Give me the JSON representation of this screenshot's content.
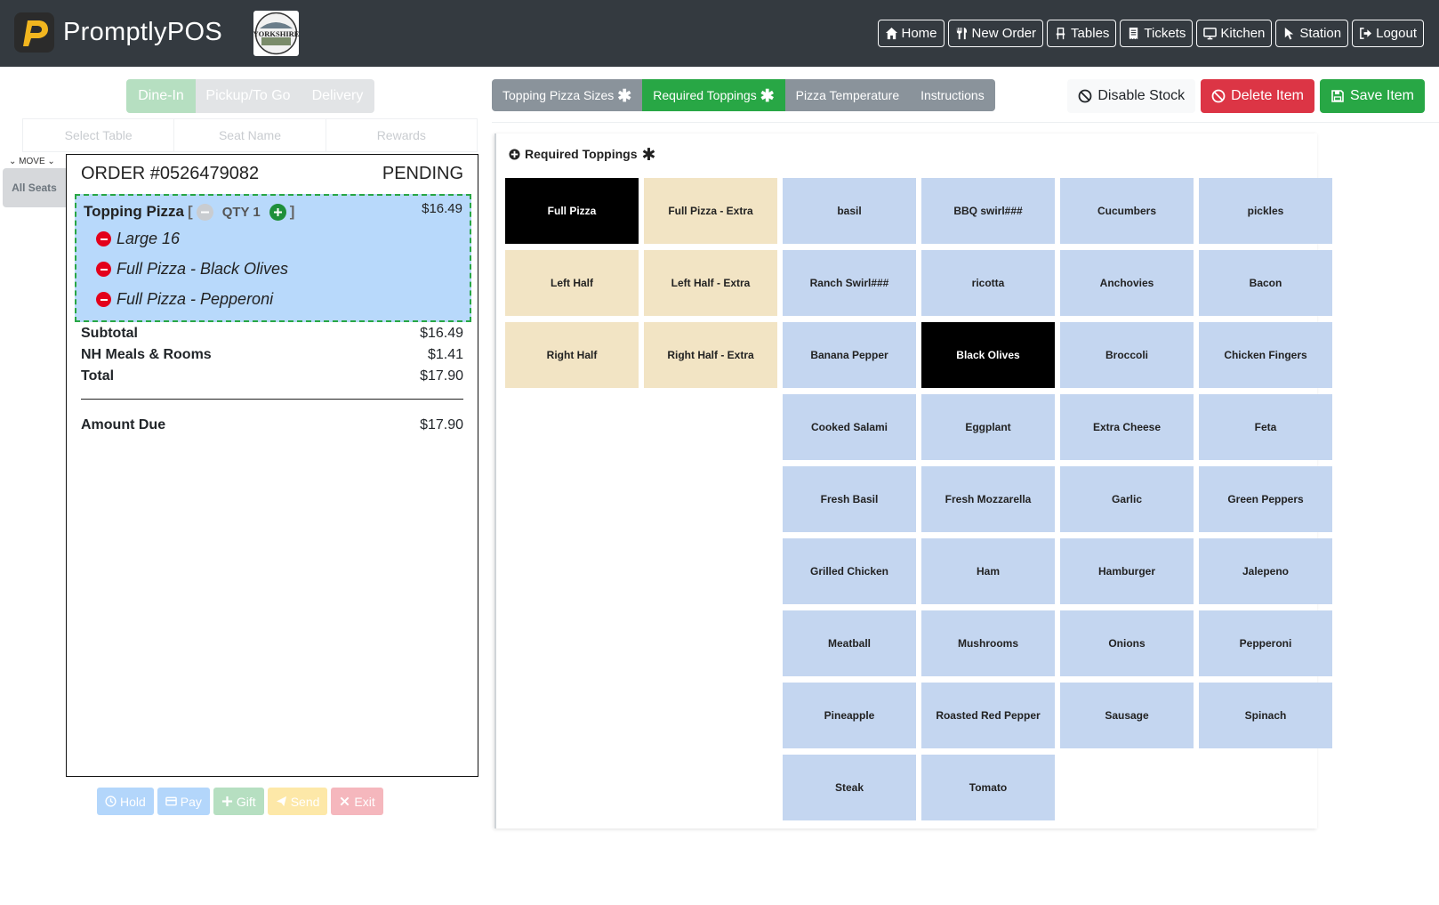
{
  "brand": {
    "name": "PromptlyPOS",
    "logo_letter": "P",
    "partner_text": "YORKSHIRE"
  },
  "nav": [
    {
      "label": "Home",
      "icon": "home-icon"
    },
    {
      "label": "New Order",
      "icon": "utensils-icon"
    },
    {
      "label": "Tables",
      "icon": "chair-icon"
    },
    {
      "label": "Tickets",
      "icon": "receipt-icon"
    },
    {
      "label": "Kitchen",
      "icon": "monitor-icon"
    },
    {
      "label": "Station",
      "icon": "pointer-icon"
    },
    {
      "label": "Logout",
      "icon": "logout-icon"
    }
  ],
  "order_types": [
    "Dine-In",
    "Pickup/To Go",
    "Delivery"
  ],
  "subbar": [
    "Select Table",
    "Seat Name",
    "Rewards"
  ],
  "seats": {
    "move_label": "MOVE",
    "all_seats": "All Seats"
  },
  "order": {
    "number": "ORDER #0526479082",
    "status": "PENDING",
    "item": {
      "name": "Topping Pizza",
      "qty": "QTY 1",
      "price": "$16.49",
      "open_bracket": "[",
      "close_bracket": "]",
      "modifiers": [
        "Large 16",
        "Full Pizza - Black Olives",
        "Full Pizza - Pepperoni"
      ]
    },
    "subtotal_label": "Subtotal",
    "subtotal": "$16.49",
    "tax_label": "NH Meals & Rooms",
    "tax": "$1.41",
    "total_label": "Total",
    "total": "$17.90",
    "due_label": "Amount Due",
    "due": "$17.90"
  },
  "actions": [
    "Hold",
    "Pay",
    "Gift",
    "Send",
    "Exit"
  ],
  "tabs": [
    "Topping Pizza Sizes",
    "Required Toppings",
    "Pizza Temperature",
    "Instructions"
  ],
  "right_actions": {
    "disable": "Disable Stock",
    "delete": "Delete Item",
    "save": "Save Item"
  },
  "panel": {
    "title": "Required Toppings"
  },
  "placements": [
    [
      "Full Pizza",
      "Full Pizza - Extra"
    ],
    [
      "Left Half",
      "Left Half - Extra"
    ],
    [
      "Right Half",
      "Right Half - Extra"
    ]
  ],
  "selected_placement": "Full Pizza",
  "toppings": [
    "basil",
    "BBQ swirl###",
    "Cucumbers",
    "pickles",
    "Ranch Swirl###",
    "ricotta",
    "Anchovies",
    "Bacon",
    "Banana Pepper",
    "Black Olives",
    "Broccoli",
    "Chicken Fingers",
    "Cooked Salami",
    "Eggplant",
    "Extra Cheese",
    "Feta",
    "Fresh Basil",
    "Fresh Mozzarella",
    "Garlic",
    "Green Peppers",
    "Grilled Chicken",
    "Ham",
    "Hamburger",
    "Jalepeno",
    "Meatball",
    "Mushrooms",
    "Onions",
    "Pepperoni",
    "Pineapple",
    "Roasted Red Pepper",
    "Sausage",
    "Spinach",
    "Steak",
    "Tomato"
  ],
  "selected_toppings": [
    "Black Olives"
  ],
  "colors": {
    "header": "#343a40",
    "selected": "#000000",
    "topping": "#c4d6f0",
    "placement": "#f2e4c4",
    "success": "#28a745",
    "danger": "#dc3545"
  }
}
